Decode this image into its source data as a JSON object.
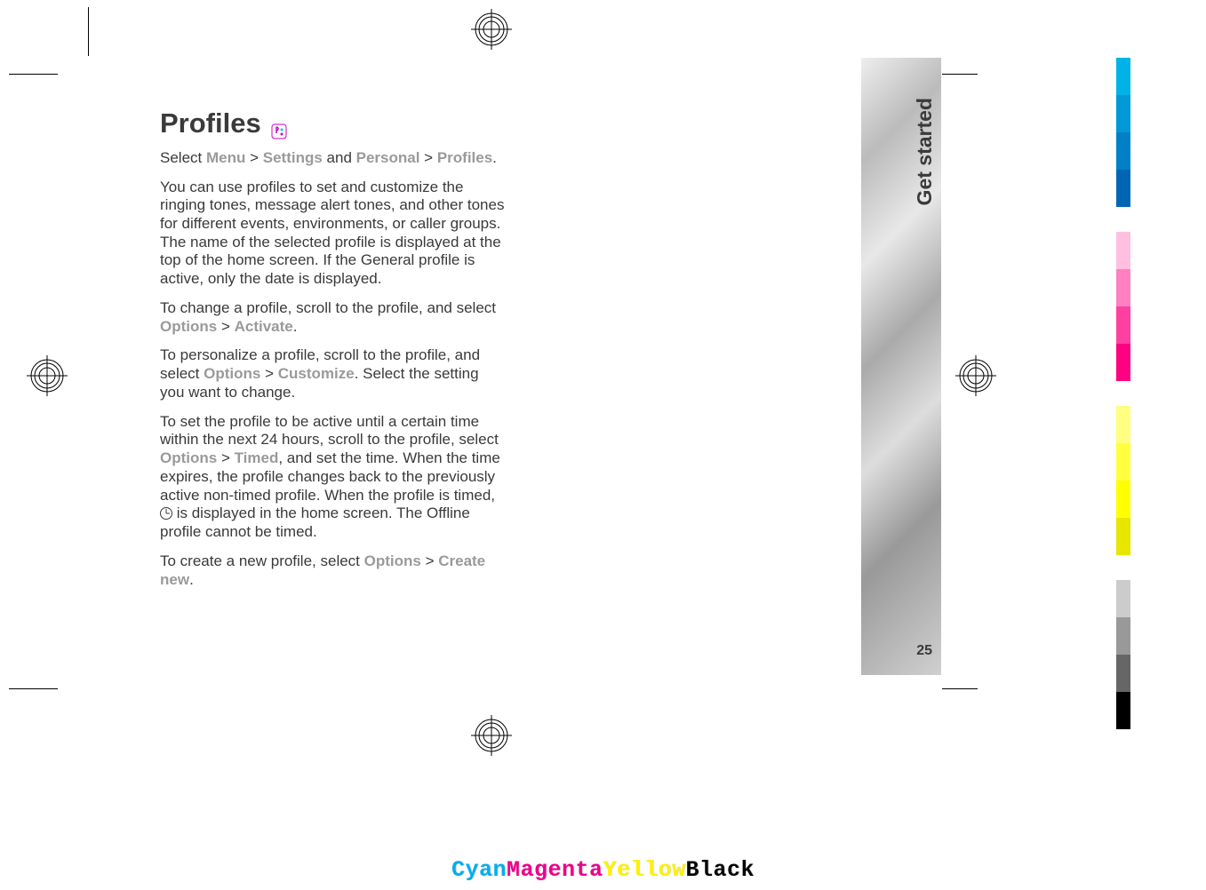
{
  "page": {
    "title": "Profiles",
    "section_tab": "Get started",
    "page_number": "25"
  },
  "content": {
    "nav_prefix": "Select ",
    "nav_menu": "Menu",
    "nav_gt1": " > ",
    "nav_settings": "Settings",
    "nav_and": " and ",
    "nav_personal": "Personal",
    "nav_gt2": " > ",
    "nav_profiles": "Profiles",
    "nav_period": ".",
    "para_intro": "You can use profiles to set and customize the ringing tones, message alert tones, and other tones for different events, environments, or caller groups. The name of the selected profile is displayed at the top of the home screen. If the General profile is active, only the date is displayed.",
    "change_a": "To change a profile, scroll to the profile, and select ",
    "change_opt": "Options",
    "change_gt": " > ",
    "change_act": "Activate",
    "change_p": ".",
    "pers_a": "To personalize a profile, scroll to the profile, and select ",
    "pers_opt": "Options",
    "pers_gt": " > ",
    "pers_cust": "Customize",
    "pers_b": ". Select the setting you want to change.",
    "timed_a": "To set the profile to be active until a certain time within the next 24 hours, scroll to the profile, select ",
    "timed_opt": "Options",
    "timed_gt": " > ",
    "timed_t": "Timed",
    "timed_b": ", and set the time. When the time expires, the profile changes back to the previously active non-timed profile. When the profile is timed, ",
    "timed_c": " is displayed in the home screen. The Offline profile cannot be timed.",
    "create_a": "To create a new profile, select ",
    "create_opt": "Options",
    "create_gt": " > ",
    "create_cn": "Create new",
    "create_p": "."
  },
  "cmyk": {
    "c": "Cyan",
    "m": "Magenta",
    "y": "Yellow",
    "k": "Black"
  },
  "colorbar": [
    "#00b3e6",
    "#0099d6",
    "#0080c6",
    "#0066b3",
    "#ffc0e0",
    "#ff80c0",
    "#ff40a0",
    "#ff0080",
    "#ffff80",
    "#ffff40",
    "#ffff00",
    "#e6e600",
    "#cccccc",
    "#999999",
    "#666666",
    "#000000"
  ]
}
